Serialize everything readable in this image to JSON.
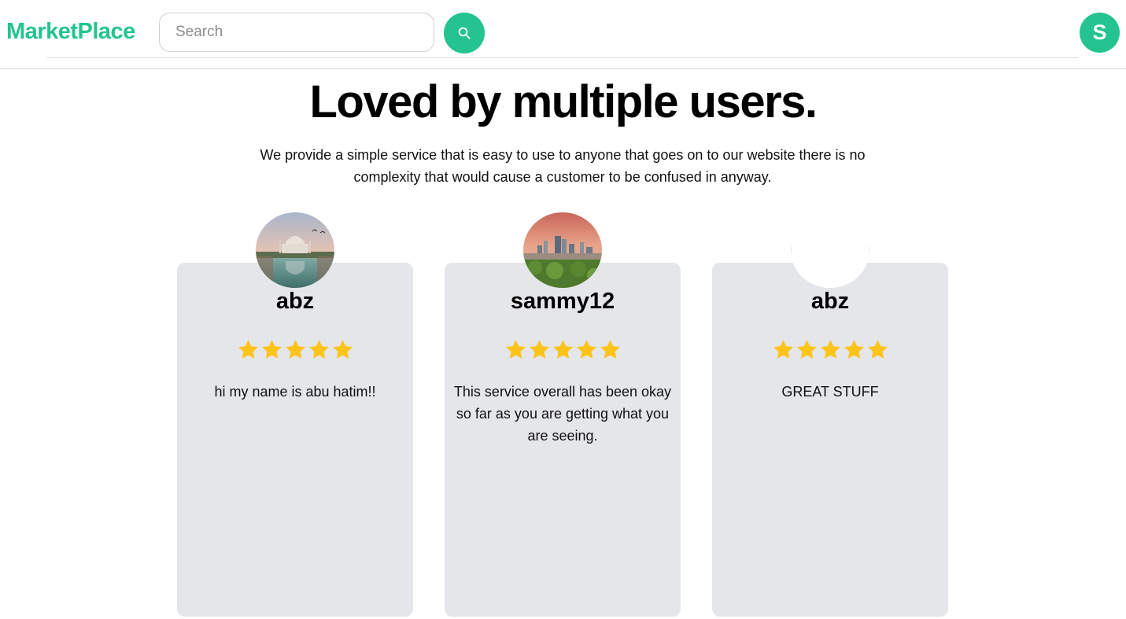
{
  "header": {
    "logo": "MarketPlace",
    "search_placeholder": "Search",
    "avatar_initial": "S"
  },
  "hero": {
    "title": "Loved by multiple users.",
    "subtitle": "We provide a simple service that is easy to use to anyone that goes on to our website there is no complexity that would cause a customer to be confused in anyway."
  },
  "reviews": [
    {
      "name": "abz",
      "rating": 5,
      "text": "hi my name is abu hatim!!",
      "photo": "taj-mahal-photo"
    },
    {
      "name": "sammy12",
      "rating": 5,
      "text": "This service overall has been okay so far as you are getting what you are seeing.",
      "photo": "city-skyline-photo"
    },
    {
      "name": "abz",
      "rating": 5,
      "text": "GREAT STUFF",
      "photo": "blank-photo"
    }
  ],
  "colors": {
    "accent": "#24c38f",
    "card_bg": "#e5e6ea",
    "star": "#fcc419"
  }
}
